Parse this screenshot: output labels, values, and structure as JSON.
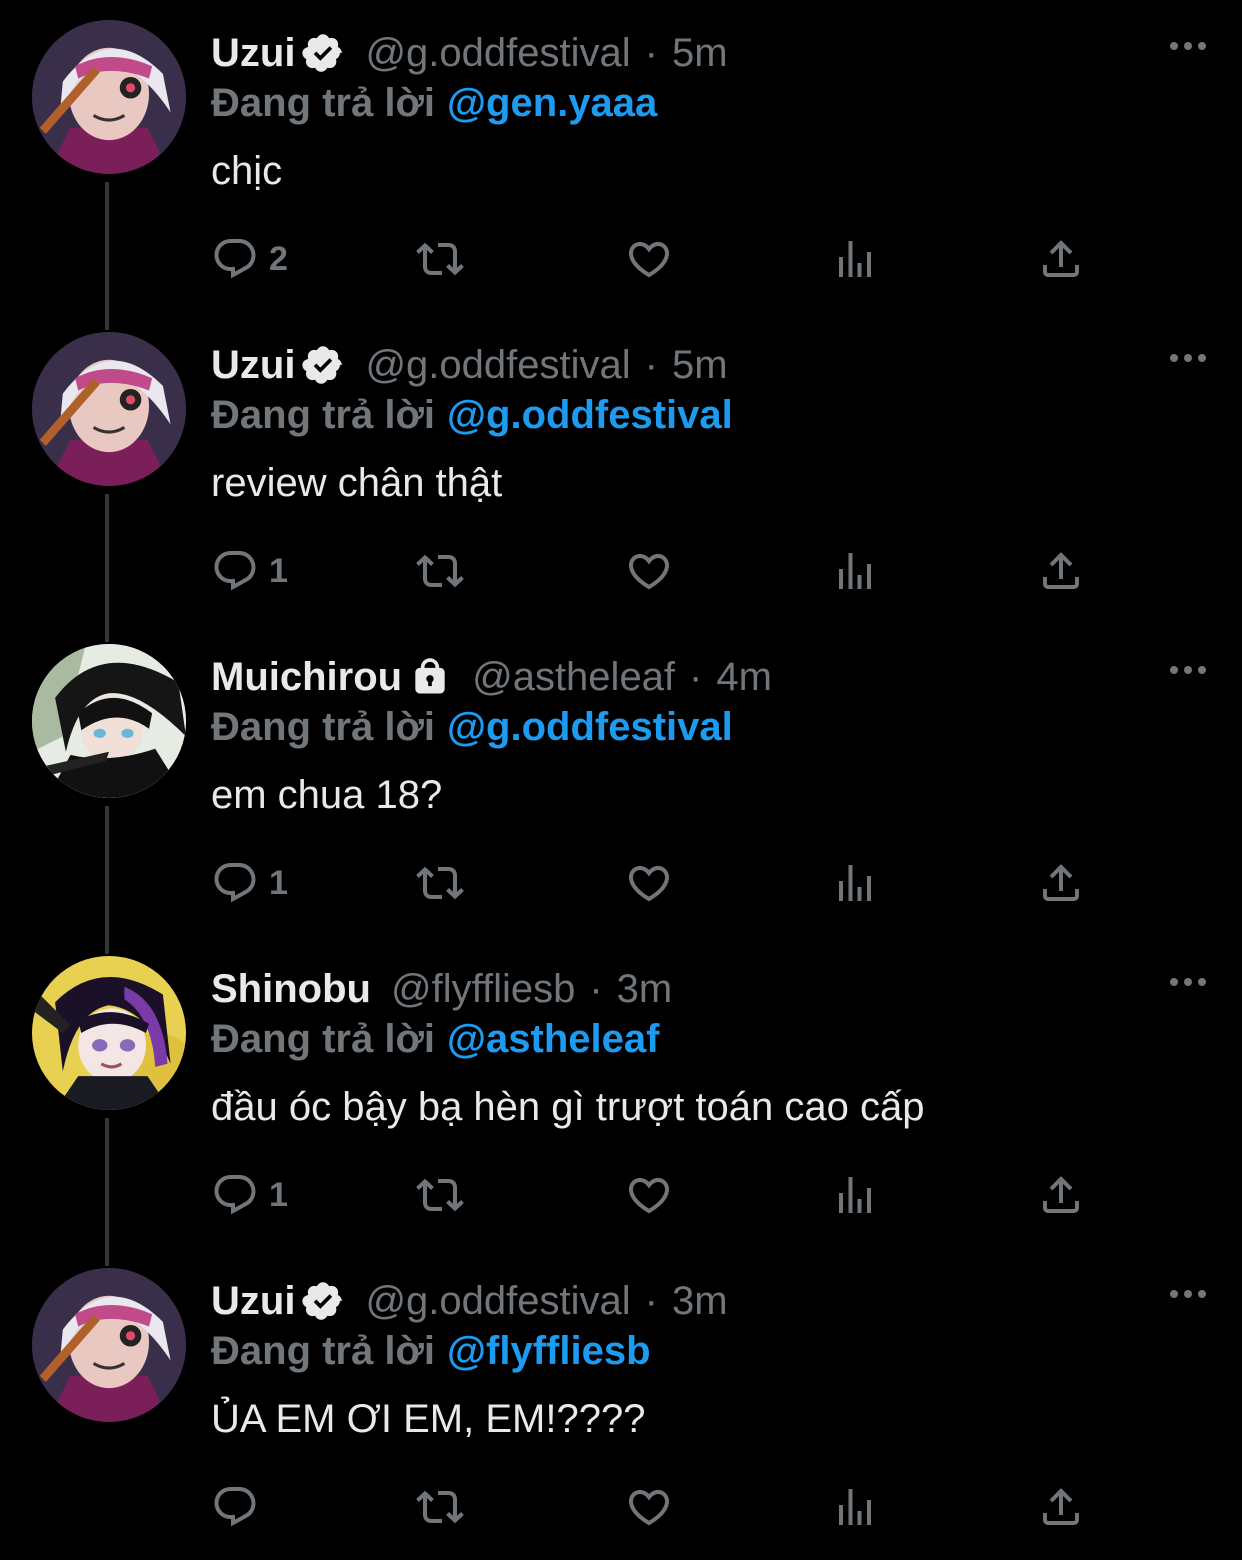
{
  "reply_label": "Đang trả lời",
  "colors": {
    "background": "#000000",
    "text": "#e7e9ea",
    "muted": "#71767b",
    "accent": "#1d9bf0"
  },
  "icons": [
    "verified-icon",
    "lock-icon",
    "more-icon",
    "reply-icon",
    "retweet-icon",
    "like-icon",
    "views-icon",
    "share-icon"
  ],
  "tweets": [
    {
      "name": "Uzui",
      "badge": "verified-icon",
      "handle": "@g.oddfestival",
      "dot": "·",
      "time": "5m",
      "reply_to": "@gen.yaaa",
      "text": "chịc",
      "reply_count": "2"
    },
    {
      "name": "Uzui",
      "badge": "verified-icon",
      "handle": "@g.oddfestival",
      "dot": "·",
      "time": "5m",
      "reply_to": "@g.oddfestival",
      "text": "review chân thật",
      "reply_count": "1"
    },
    {
      "name": "Muichirou",
      "badge": "lock-icon",
      "handle": "@astheleaf",
      "dot": "·",
      "time": "4m",
      "reply_to": "@g.oddfestival",
      "text": "em chua 18?",
      "reply_count": "1"
    },
    {
      "name": "Shinobu",
      "badge": "",
      "handle": "@flyffliesb",
      "dot": "·",
      "time": "3m",
      "reply_to": "@astheleaf",
      "text": "đầu óc bậy bạ hèn gì trượt toán cao cấp",
      "reply_count": "1"
    },
    {
      "name": "Uzui",
      "badge": "verified-icon",
      "handle": "@g.oddfestival",
      "dot": "·",
      "time": "3m",
      "reply_to": "@flyffliesb",
      "text": "ỦA EM ƠI EM, EM!????",
      "reply_count": ""
    }
  ]
}
